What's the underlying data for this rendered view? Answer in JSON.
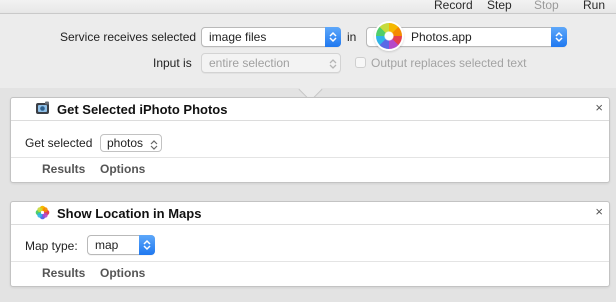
{
  "toolbar": {
    "record": "Record",
    "step": "Step",
    "stop": "Stop",
    "run": "Run"
  },
  "service": {
    "receives_label": "Service receives selected",
    "type_value": "image files",
    "in_label": "in",
    "app_value": "Photos.app",
    "input_is_label": "Input is",
    "input_is_value": "entire selection",
    "output_replaces_label": "Output replaces selected text",
    "output_replaces_checked": false,
    "app_icon": "photos-app-icon"
  },
  "actions": [
    {
      "title": "Get Selected iPhoto Photos",
      "icon": "iphoto-camera-icon",
      "field_label": "Get selected",
      "field_value": "photos",
      "tab_results": "Results",
      "tab_options": "Options",
      "close": "×"
    },
    {
      "title": "Show Location in Maps",
      "icon": "photos-flower-icon",
      "field_label": "Map type:",
      "field_value": "map",
      "tab_results": "Results",
      "tab_options": "Options",
      "close": "×"
    }
  ],
  "colors": {
    "accent": "#1f78f0",
    "background": "#e3e3e3"
  }
}
